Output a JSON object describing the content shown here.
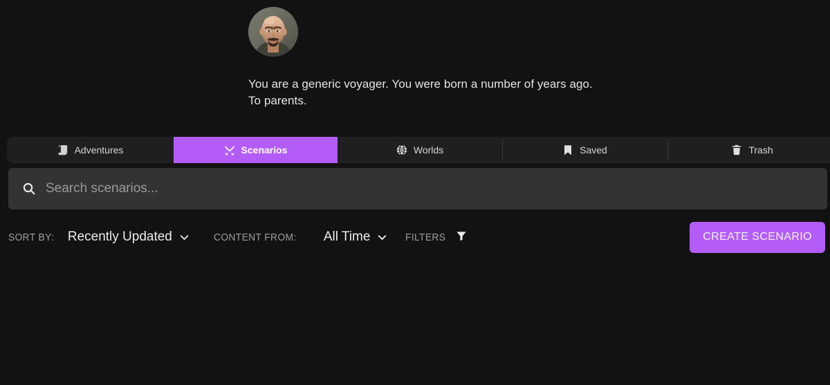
{
  "theme": {
    "background": "#121212",
    "accent": "#b35cf7",
    "tabbar_background": "#1f1f1f",
    "search_background": "#333333",
    "text_primary": "#e8e8e8",
    "text_muted": "#9e9e9e"
  },
  "profile": {
    "avatar_name": "bald-bearded-man-portrait",
    "bio": "You are a generic voyager. You were born a number of years ago. To parents."
  },
  "tabs": [
    {
      "label": "Adventures",
      "icon": "scroll-icon",
      "active": false
    },
    {
      "label": "Scenarios",
      "icon": "crossed-swords-icon",
      "active": true
    },
    {
      "label": "Worlds",
      "icon": "globe-icon",
      "active": false
    },
    {
      "label": "Saved",
      "icon": "bookmark-icon",
      "active": false
    },
    {
      "label": "Trash",
      "icon": "trash-icon",
      "active": false
    }
  ],
  "search": {
    "icon": "search-icon",
    "placeholder": "Search scenarios...",
    "value": ""
  },
  "filters": {
    "sort_by_label": "SORT BY:",
    "sort_by_value": "Recently Updated",
    "sort_by_icon": "chevron-down-icon",
    "content_from_label": "CONTENT FROM:",
    "content_from_value": "All Time",
    "content_from_icon": "chevron-down-icon",
    "filters_label": "FILTERS",
    "filters_icon": "funnel-icon"
  },
  "actions": {
    "create_label": "CREATE SCENARIO"
  }
}
